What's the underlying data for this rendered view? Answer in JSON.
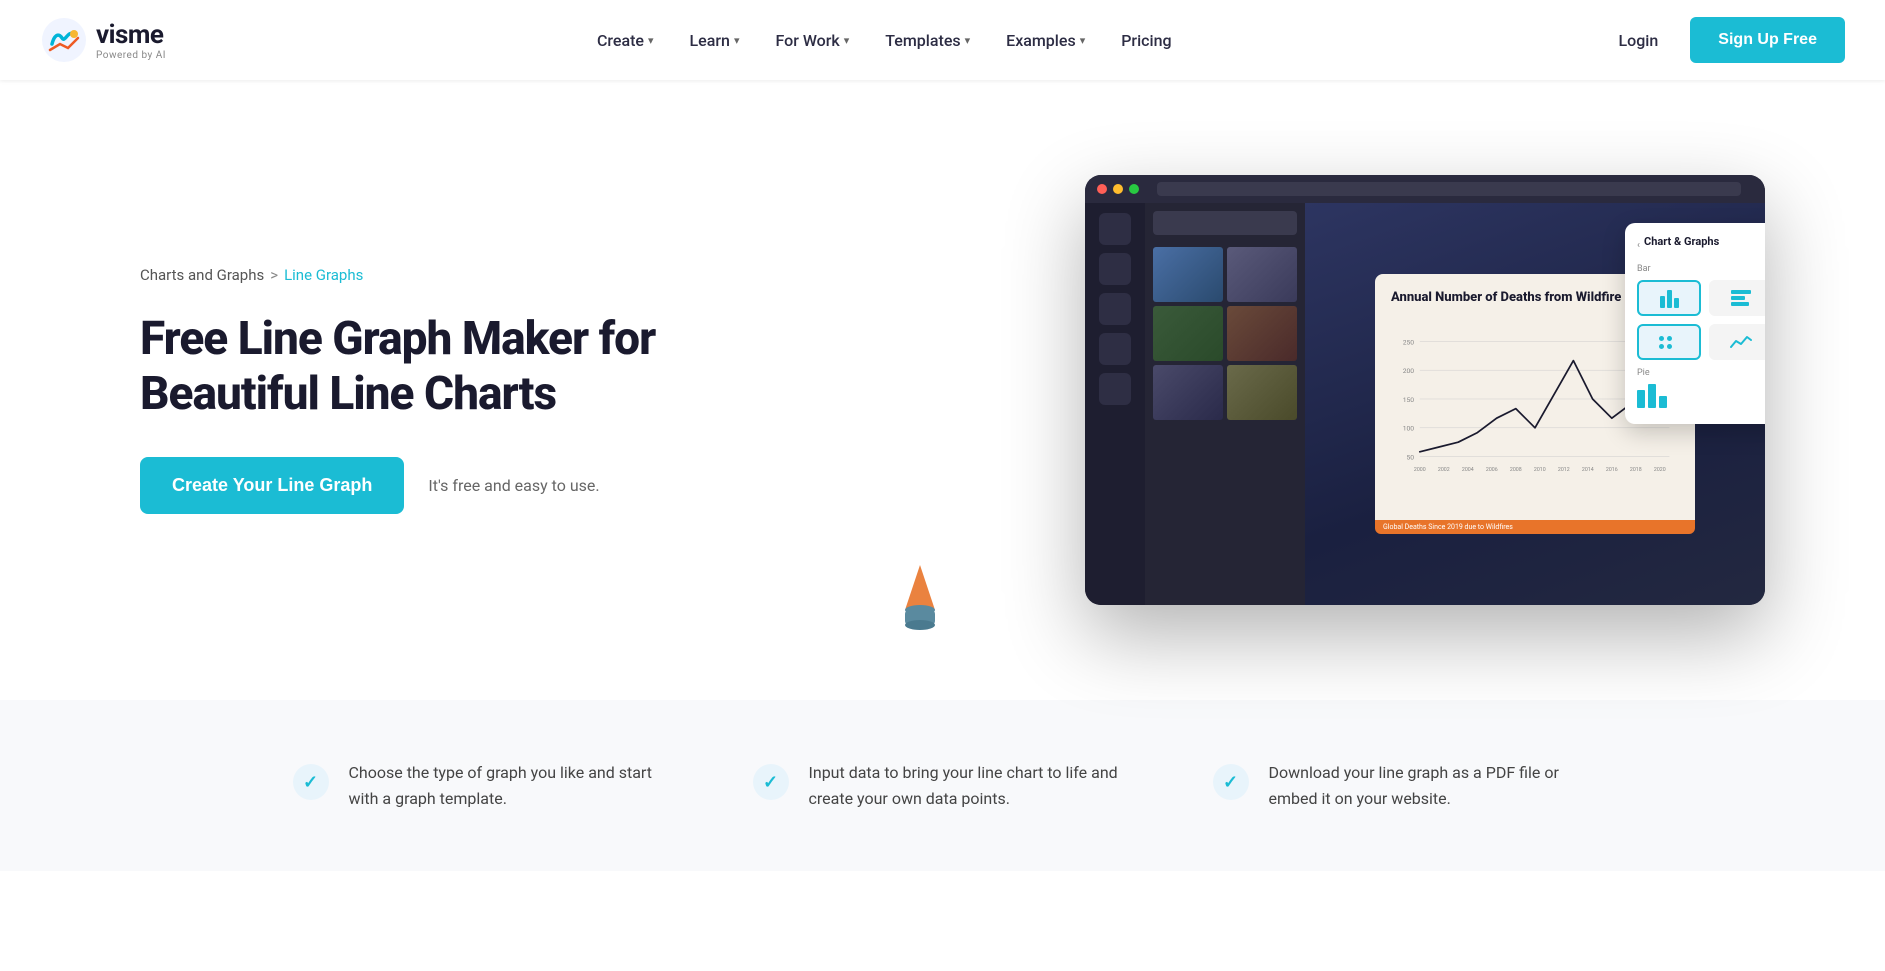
{
  "brand": {
    "name": "visme",
    "sub": "Powered by AI",
    "logo_colors": [
      "#00b4d8",
      "#f7b731",
      "#ee5a24"
    ]
  },
  "nav": {
    "create_label": "Create",
    "learn_label": "Learn",
    "forwork_label": "For Work",
    "templates_label": "Templates",
    "examples_label": "Examples",
    "pricing_label": "Pricing",
    "login_label": "Login",
    "signup_label": "Sign Up Free"
  },
  "breadcrumb": {
    "parent": "Charts and Graphs",
    "separator": ">",
    "current": "Line Graphs"
  },
  "hero": {
    "title": "Free Line Graph Maker for Beautiful Line Charts",
    "cta_label": "Create Your Line Graph",
    "cta_note": "It's free and easy to use."
  },
  "chart": {
    "title": "Annual Number of Deaths from Wildfire",
    "footer": "Global Deaths Since 2019 due to Wildfires"
  },
  "panel": {
    "title": "Chart & Graphs",
    "bar_section": "Bar",
    "pie_section": "Pie"
  },
  "features": [
    {
      "text": "Choose the type of graph you like and start with a graph template."
    },
    {
      "text": "Input data to bring your line chart to life and create your own data points."
    },
    {
      "text": "Download your line graph as a PDF file or embed it on your website."
    }
  ]
}
